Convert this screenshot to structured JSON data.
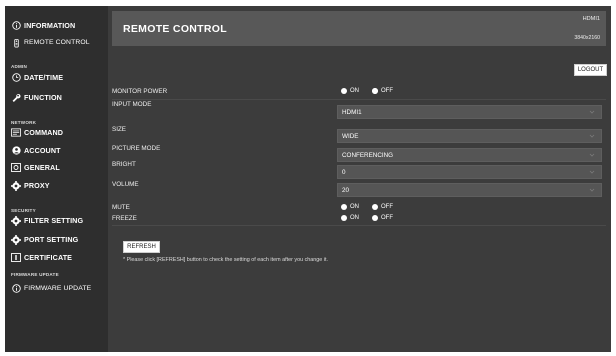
{
  "sidebar": {
    "information": "INFORMATION",
    "remote_control": "REMOTE CONTROL",
    "admin_head": "ADMIN",
    "date_time": "DATE/TIME",
    "function": "FUNCTION",
    "network_head": "NETWORK",
    "command": "COMMAND",
    "account": "ACCOUNT",
    "general": "GENERAL",
    "proxy": "PROXY",
    "security_head": "SECURITY",
    "filter_setting": "FILTER SETTING",
    "port_setting": "PORT SETTING",
    "certificate": "CERTIFICATE",
    "firmware_head": "FIRMWARE UPDATE",
    "firmware_update": "FIRMWARE UPDATE"
  },
  "banner": {
    "title": "REMOTE CONTROL",
    "input": "HDMI1",
    "resolution": "3840x2160"
  },
  "logout_label": "LOGOUT",
  "settings": {
    "monitor_power": {
      "label": "MONITOR POWER",
      "on": "ON",
      "off": "OFF",
      "selected": "on"
    },
    "input_mode": {
      "label": "INPUT MODE",
      "value": "HDMI1"
    },
    "size": {
      "label": "SIZE",
      "value": "WIDE"
    },
    "picture_mode": {
      "label": "PICTURE MODE",
      "value": "CONFERENCING"
    },
    "bright": {
      "label": "BRIGHT",
      "value": "0"
    },
    "volume": {
      "label": "VOLUME",
      "value": "20"
    },
    "mute": {
      "label": "MUTE",
      "on": "ON",
      "off": "OFF",
      "selected": "off"
    },
    "freeze": {
      "label": "FREEZE",
      "on": "ON",
      "off": "OFF",
      "selected": "off"
    }
  },
  "refresh_label": "REFRESH",
  "note": "* Please click [REFRESH] button to check the setting of each item after you change it.",
  "colors": {
    "sidebar_bg": "#2e2e2e",
    "main_bg": "#3c3c3c",
    "banner_bg": "#585858",
    "select_bg": "#555555"
  }
}
